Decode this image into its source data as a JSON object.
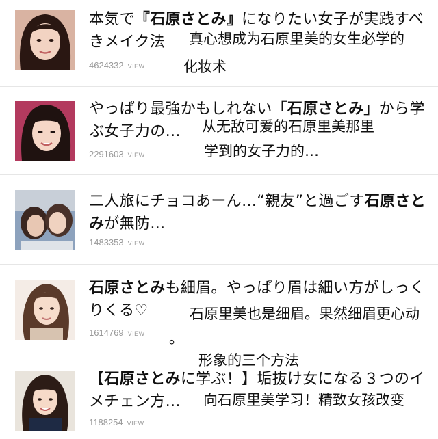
{
  "view_label": "VIEW",
  "items": [
    {
      "title_pre": "本気で",
      "title_bold": "『石原さとみ』",
      "title_post": "になりたい女子が実践すべきメイク法",
      "views": "4624332",
      "cn_caption": "真心想成为石原里美的女生必学的",
      "cn_caption2": "化妆术"
    },
    {
      "title_pre": "やっぱり最強かもしれない",
      "title_bold": "「石原さとみ」",
      "title_post": "から学ぶ女子力の…",
      "views": "2291603",
      "cn_caption": "从无敌可爱的石原里美那里",
      "cn_caption2": "学到的女子力的…"
    },
    {
      "title_pre": "二人旅にチョコあーん…“親友”と過ごす",
      "title_bold": "石原さとみ",
      "title_post": "が無防…",
      "views": "1483353",
      "cn_caption": "",
      "cn_caption2": ""
    },
    {
      "title_pre": "",
      "title_bold": "石原さとみ",
      "title_post": "も細眉。やっぱり眉は細い方がしっくりくる♡",
      "views": "1614769",
      "cn_caption": "石原里美也是细眉。果然细眉更心动",
      "cn_caption2": "。"
    },
    {
      "title_pre": "【",
      "title_bold": "石原さとみ",
      "title_post": "に学ぶ！】垢抜け女になる３つのイメチェン方…",
      "views": "1188254",
      "cn_caption": "向石原里美学习！精致女孩改变",
      "cn_caption2": "形象的三个方法"
    }
  ]
}
